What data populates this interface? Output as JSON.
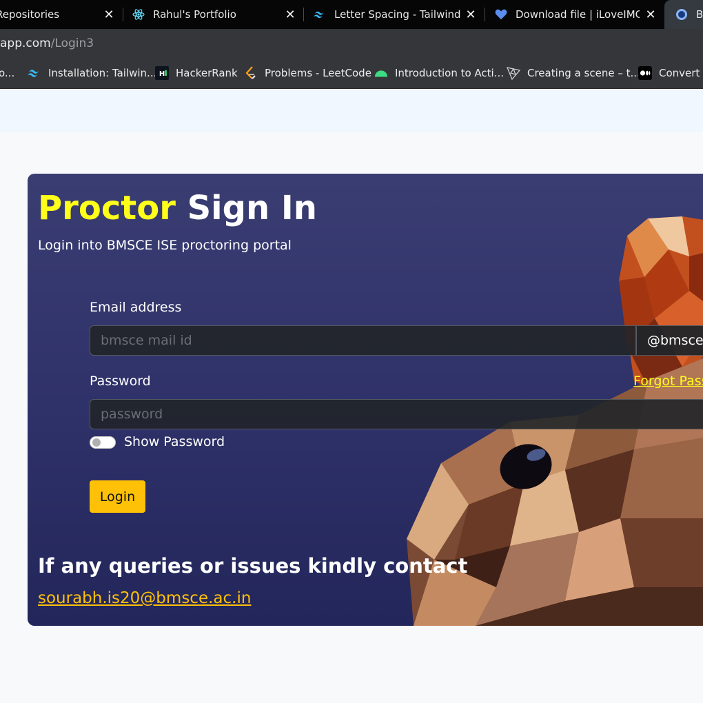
{
  "browser": {
    "tabs": [
      {
        "title": "Repositories",
        "icon": "github-icon"
      },
      {
        "title": "Rahul's Portfolio",
        "icon": "react-icon"
      },
      {
        "title": "Letter Spacing - Tailwind CSS",
        "icon": "tailwind-icon"
      },
      {
        "title": "Download file | iLoveIMG",
        "icon": "heart-icon"
      },
      {
        "title": "BI",
        "icon": "globe-icon"
      }
    ],
    "tab_close_symbol": "✕",
    "address": {
      "host": "app.com",
      "path": "/Login3"
    },
    "bookmarks": [
      {
        "label": "o...",
        "icon": "folder-icon"
      },
      {
        "label": "Installation: Tailwin...",
        "icon": "tailwind-icon"
      },
      {
        "label": "HackerRank",
        "icon": "hackerrank-icon"
      },
      {
        "label": "Problems - LeetCode",
        "icon": "leetcode-icon"
      },
      {
        "label": "Introduction to Acti...",
        "icon": "android-icon"
      },
      {
        "label": "Creating a scene – t...",
        "icon": "threejs-icon"
      },
      {
        "label": "Convert D",
        "icon": "medium-icon"
      }
    ]
  },
  "login": {
    "title_highlight": "Proctor",
    "title_rest": " Sign In",
    "subtitle": "Login into BMSCE ISE proctoring portal",
    "email_label": "Email address",
    "email_placeholder": "bmsce mail id",
    "email_value": "",
    "email_suffix": "@bmsce.ac.in",
    "password_label": "Password",
    "password_placeholder": "password",
    "password_value": "",
    "forgot_label": "Forgot Password?",
    "show_password_label": "Show Password",
    "show_password_on": false,
    "login_button": "Login",
    "contact_heading": "If any queries or issues kindly contact",
    "contact_email": "sourabh.is20@bmsce.ac.in"
  },
  "colors": {
    "accent_yellow": "#ffff1a",
    "button_yellow": "#ffc107",
    "card_bg": "#2e3168",
    "page_bg": "#f8f9fa"
  }
}
